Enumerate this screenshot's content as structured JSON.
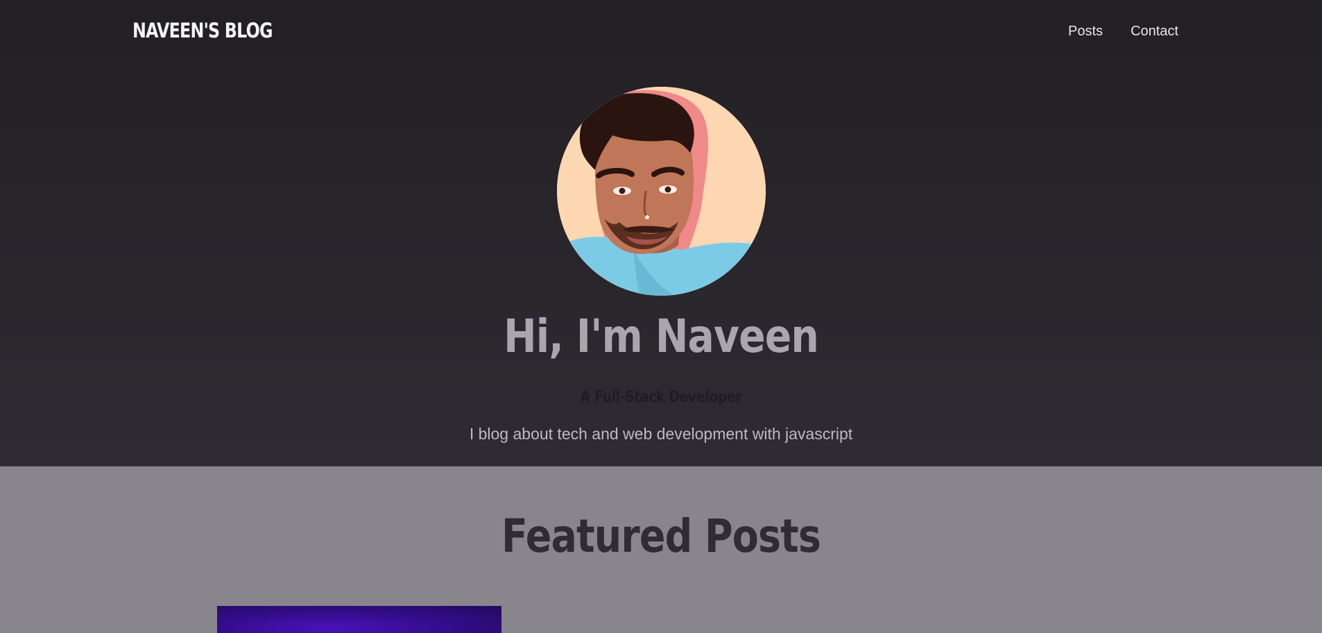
{
  "header": {
    "logo": "NAVEEN'S BLOG",
    "nav": [
      {
        "label": "Posts"
      },
      {
        "label": "Contact"
      }
    ]
  },
  "hero": {
    "title": "Hi, I'm Naveen",
    "subtitle": "A Full-Stack Developer",
    "description": "I blog about tech and web development with javascript"
  },
  "featured": {
    "title": "Featured Posts"
  },
  "colors": {
    "hero_bg": "#262428",
    "featured_bg": "#88868c",
    "post_thumb": "#3a0ea0"
  }
}
